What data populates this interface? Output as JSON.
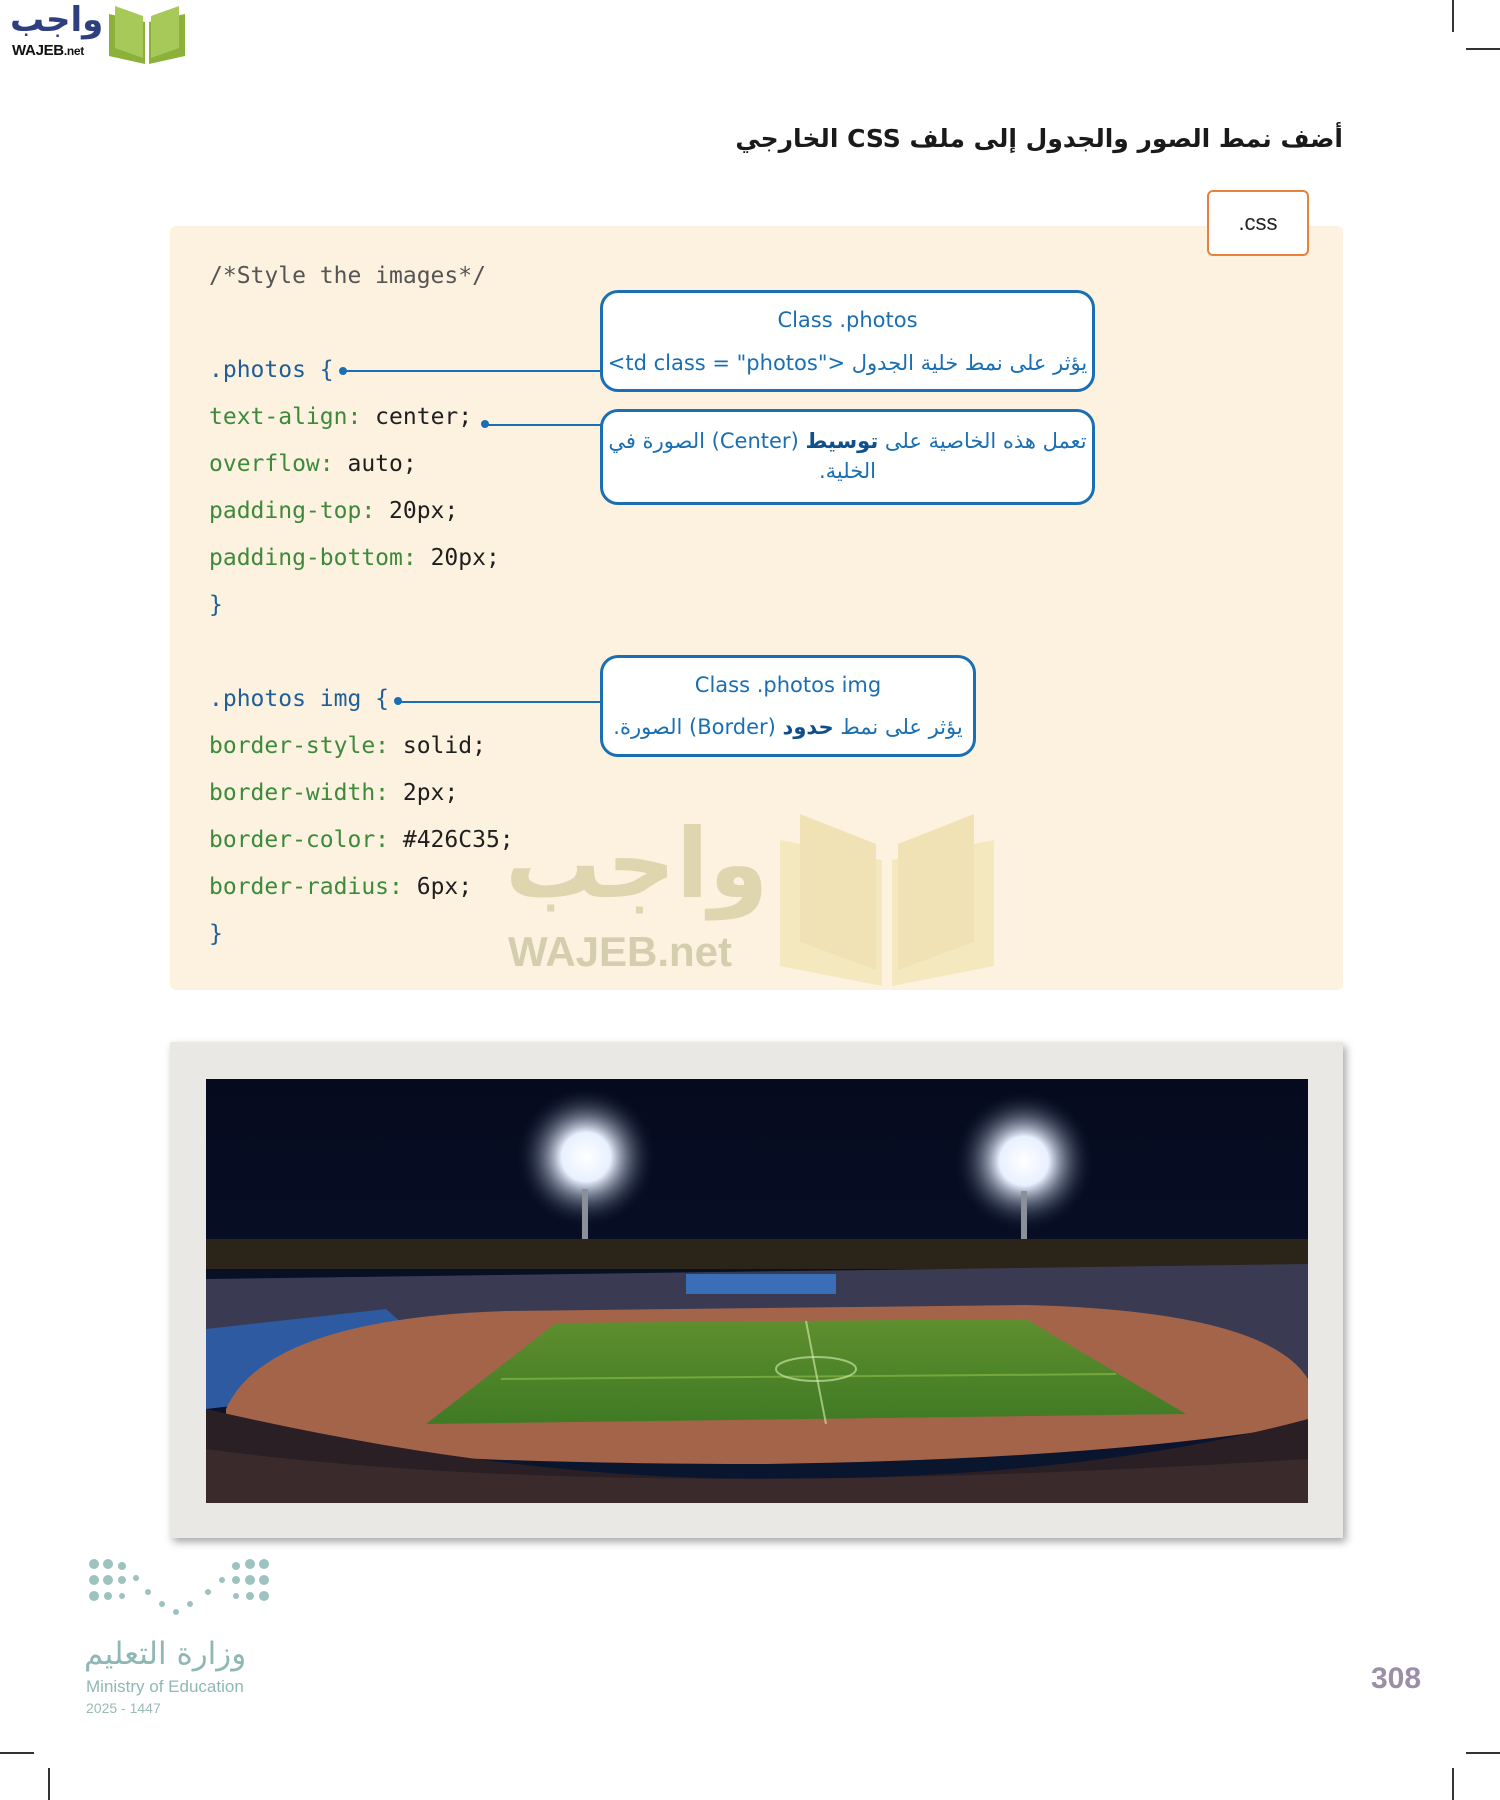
{
  "logo": {
    "arabic": "واجب",
    "latin": "WAJEB",
    "suffix": ".net"
  },
  "heading": "أضف نمط الصور والجدول إلى ملف CSS الخارجي",
  "file_tab": ".css",
  "code": {
    "comment": "/*Style the images*/",
    "photos_selector": ".photos {",
    "text_align_prop": "text-align:",
    "text_align_val": " center;",
    "overflow_prop": "overflow:",
    "overflow_val": " auto;",
    "padding_top_prop": "padding-top:",
    "padding_top_val": " 20px;",
    "padding_bottom_prop": "padding-bottom:",
    "padding_bottom_val": " 20px;",
    "close1": "}",
    "img_selector": ".photos img {",
    "border_style_prop": "border-style:",
    "border_style_val": " solid;",
    "border_width_prop": "border-width:",
    "border_width_val": " 2px;",
    "border_color_prop": "border-color:",
    "border_color_val": " #426C35;",
    "border_radius_prop": "border-radius:",
    "border_radius_val": " 6px;",
    "close2": "}"
  },
  "callouts": {
    "photos": {
      "title": "Class .photos",
      "desc_prefix": "يؤثر على نمط خلية الجدول",
      "desc_code": "<td class = \"photos\">"
    },
    "center": {
      "part1": "تعمل هذه الخاصية على",
      "bold": "توسيط",
      "part2": "(Center) الصورة في",
      "part3": "الخلية."
    },
    "img": {
      "title": "Class .photos img",
      "part1": "يؤثر على نمط",
      "bold": "حدود",
      "part2": "(Border) الصورة."
    }
  },
  "watermark": {
    "arabic": "واجب",
    "latin": "WAJEB.net"
  },
  "ministry": {
    "arabic": "وزارة التعليم",
    "english": "Ministry of Education",
    "year": "2025 - 1447"
  },
  "page_number": "308",
  "colors": {
    "accent_blue": "#1a6fb4",
    "panel_bg": "#fdf1df",
    "tab_border": "#e8813a",
    "logo_green": "#8bb13a"
  }
}
